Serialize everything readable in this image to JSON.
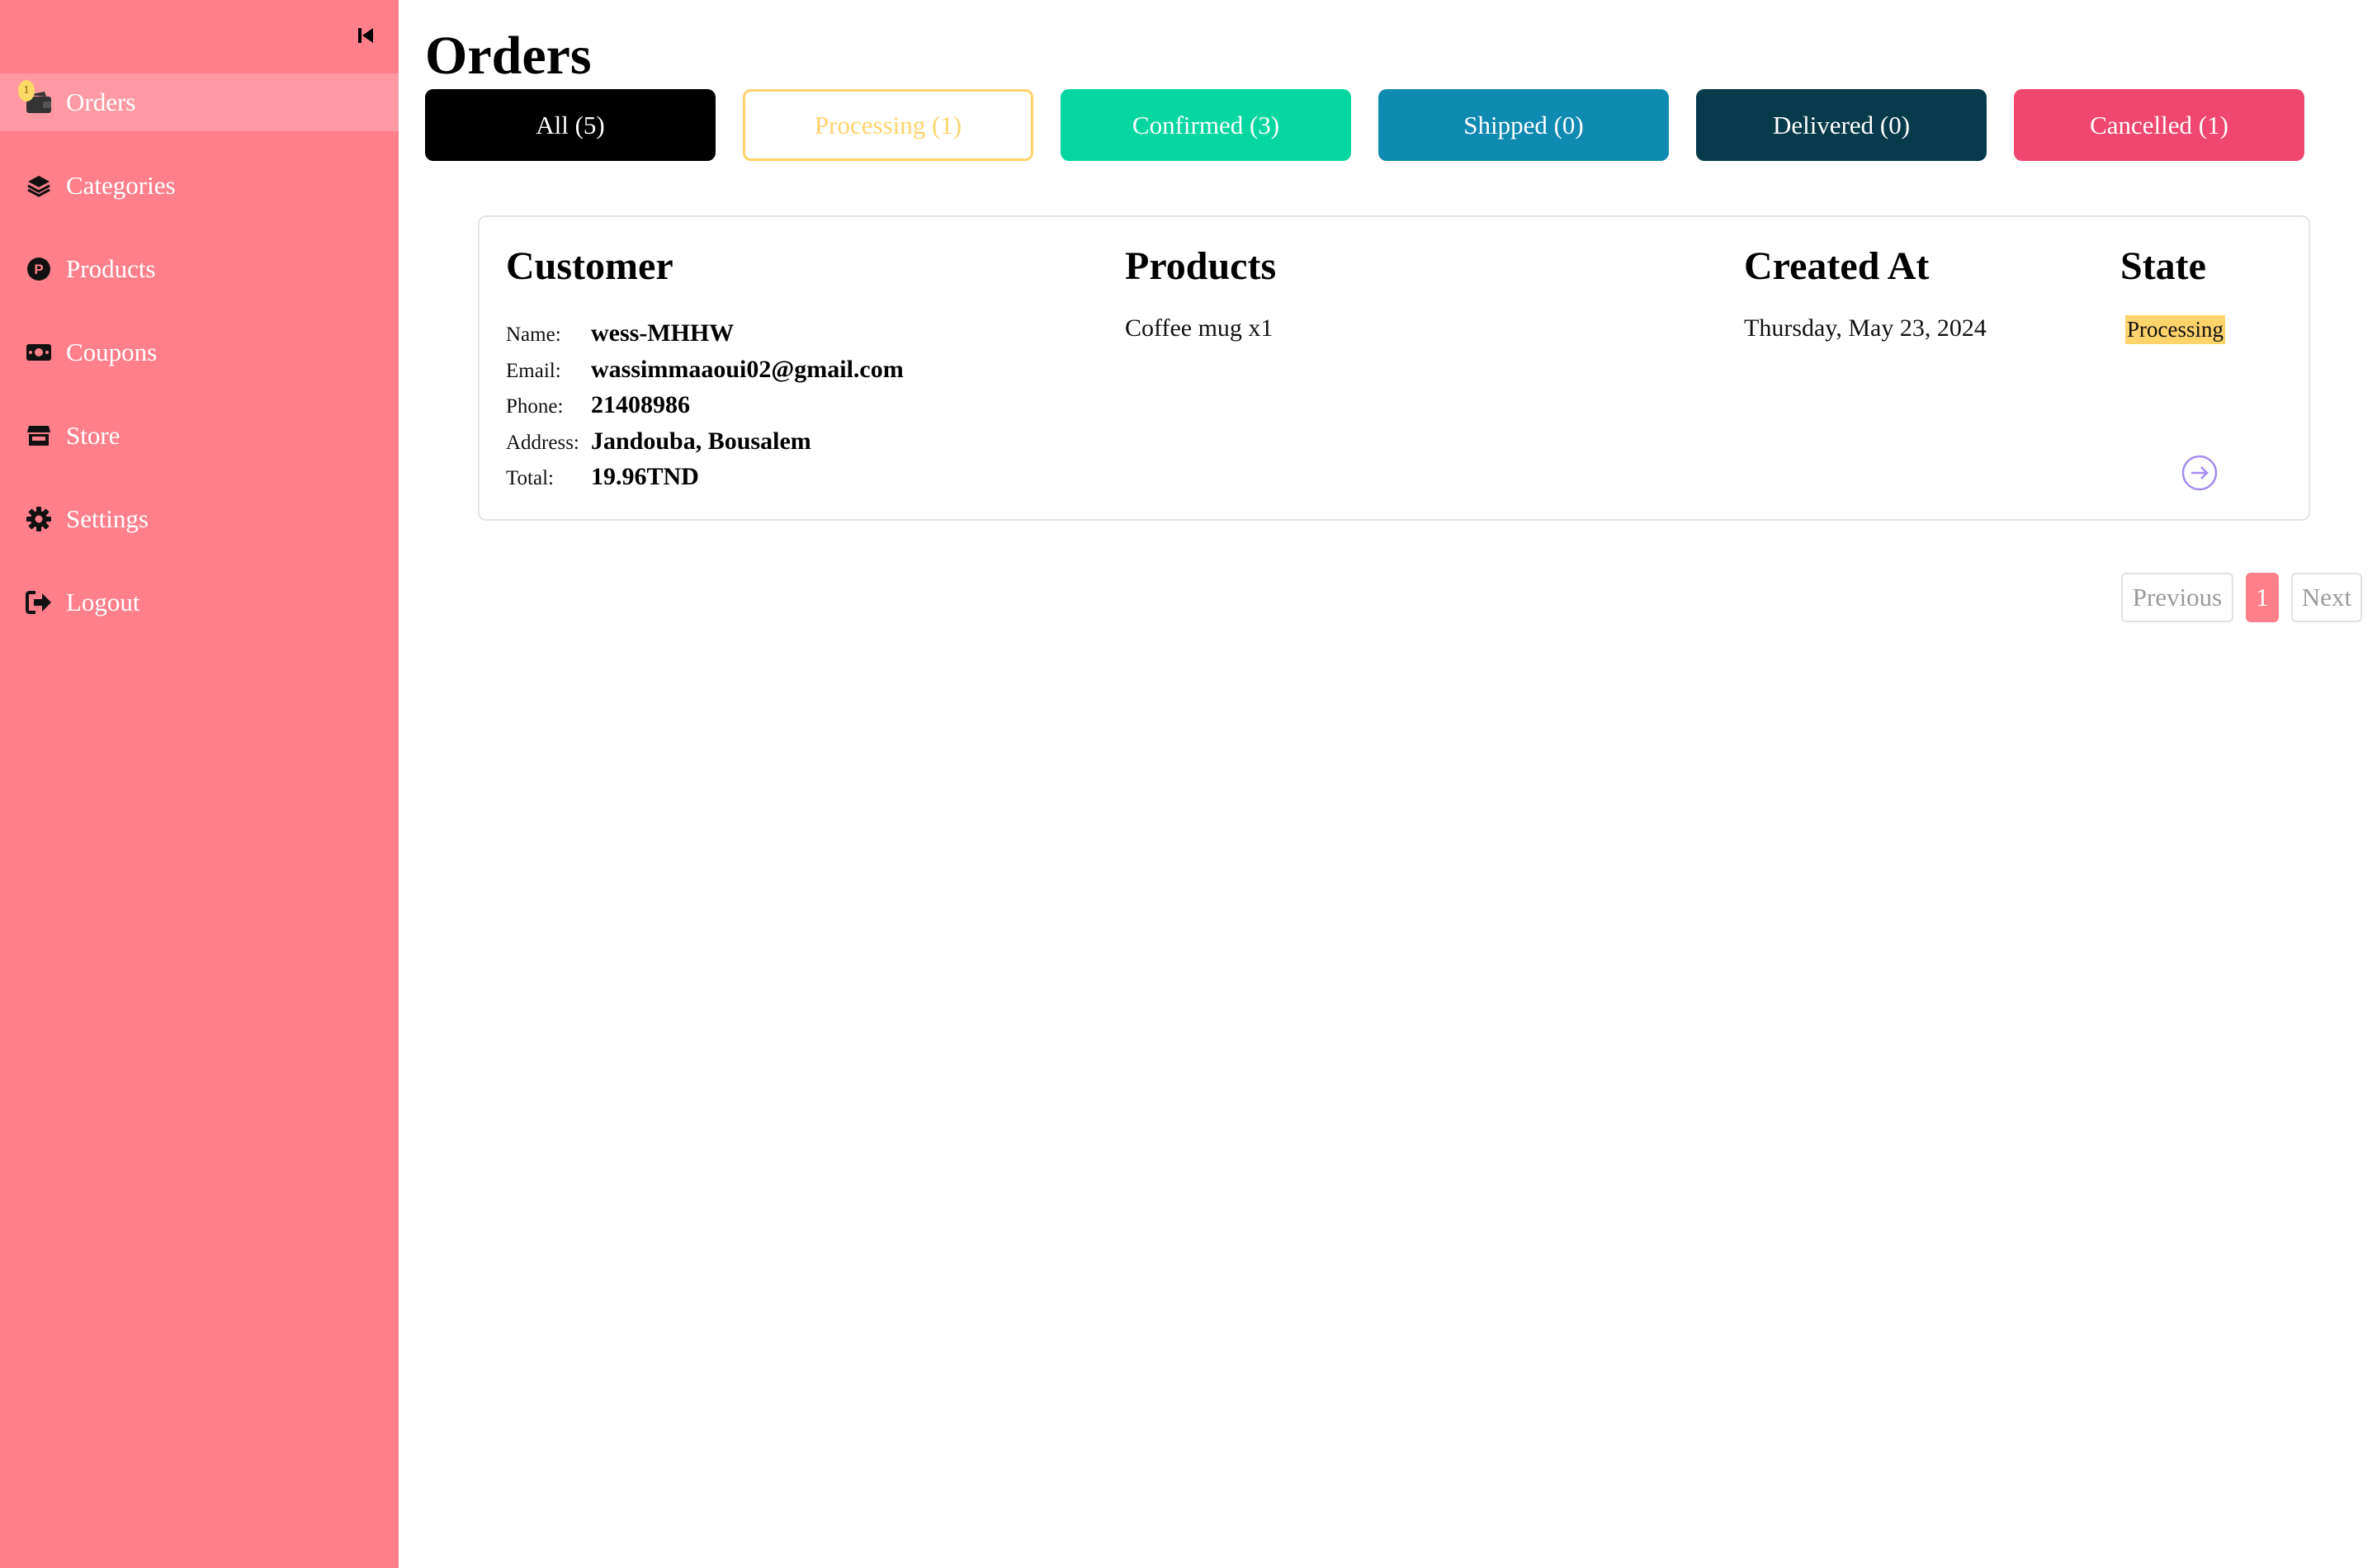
{
  "sidebar": {
    "items": [
      {
        "label": "Orders",
        "icon": "wallet-icon",
        "active": true,
        "badge": "1"
      },
      {
        "label": "Categories",
        "icon": "layers-icon"
      },
      {
        "label": "Products",
        "icon": "product-icon"
      },
      {
        "label": "Coupons",
        "icon": "money-icon"
      },
      {
        "label": "Store",
        "icon": "store-icon"
      },
      {
        "label": "Settings",
        "icon": "gear-icon"
      },
      {
        "label": "Logout",
        "icon": "logout-icon"
      }
    ]
  },
  "page": {
    "title": "Orders"
  },
  "filters": [
    {
      "label": "All (5)",
      "color": "#000000"
    },
    {
      "label": "Processing (1)",
      "color": "#ffd36b"
    },
    {
      "label": "Confirmed (3)",
      "color": "#06d6a0"
    },
    {
      "label": "Shipped (0)",
      "color": "#118ab2"
    },
    {
      "label": "Delivered (0)",
      "color": "#073b4c"
    },
    {
      "label": "Cancelled (1)",
      "color": "#ef476f"
    }
  ],
  "order": {
    "headers": {
      "customer": "Customer",
      "products": "Products",
      "created_at": "Created At",
      "state": "State"
    },
    "customer": {
      "name_key": "Name:",
      "name": "wess-MHHW",
      "email_key": "Email:",
      "email": "wassimmaaoui02@gmail.com",
      "phone_key": "Phone:",
      "phone": "21408986",
      "address_key": "Address:",
      "address": "Jandouba, Bousalem",
      "total_key": "Total:",
      "total": "19.96TND"
    },
    "products": "Coffee mug x1",
    "created_at": "Thursday, May 23, 2024",
    "state": "Processing"
  },
  "pagination": {
    "previous": "Previous",
    "current": "1",
    "next": "Next"
  }
}
